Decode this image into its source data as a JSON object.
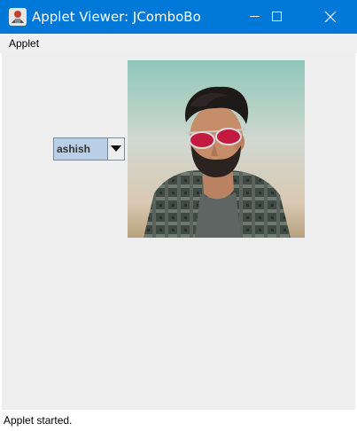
{
  "window": {
    "title": "Applet Viewer: JComboBo...",
    "controls": [
      "minimize-icon",
      "maximize-icon",
      "close-icon"
    ],
    "titlebar_color": "#0078d7"
  },
  "menu": {
    "items": [
      {
        "label": "Applet"
      }
    ]
  },
  "applet": {
    "combo": {
      "selected": "ashish",
      "background": "#b8cfe5"
    },
    "image": {
      "subject": "photo-of-man-with-red-sunglasses"
    }
  },
  "status": {
    "text": "Applet started."
  }
}
